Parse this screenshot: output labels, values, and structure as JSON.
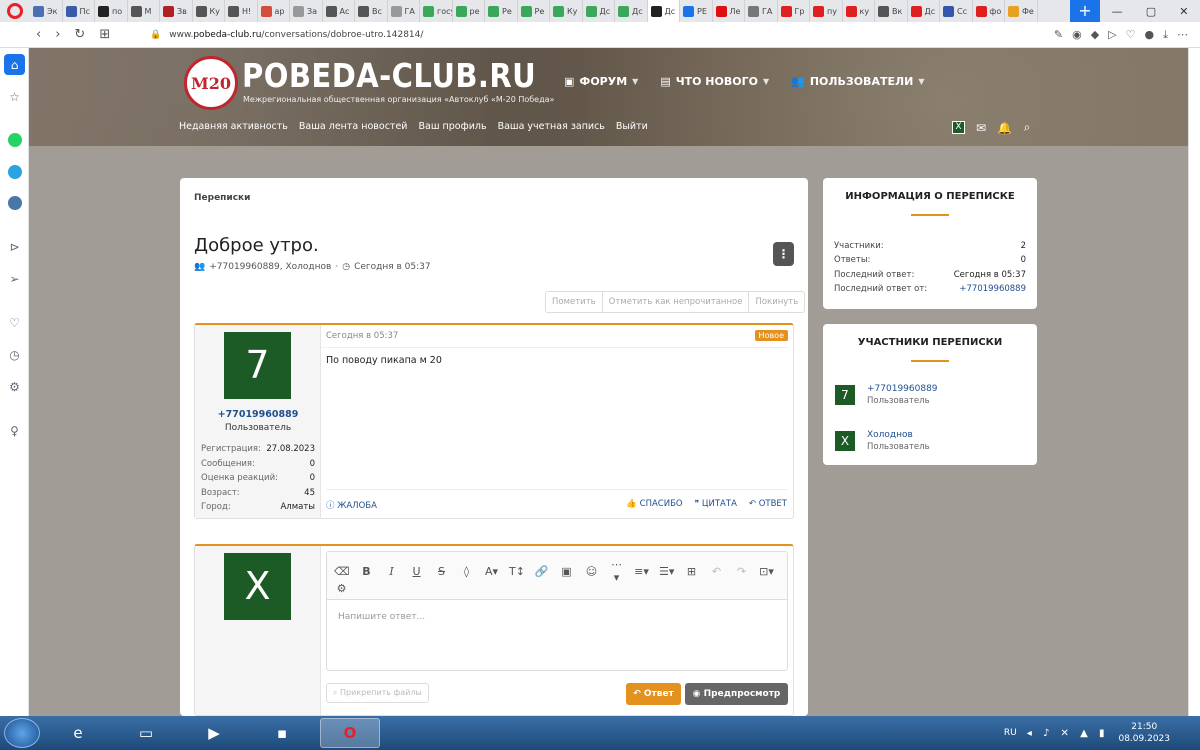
{
  "browser": {
    "tabs": [
      {
        "label": "Эк",
        "color": "#4a6fb5"
      },
      {
        "label": "Пс",
        "color": "#3a5ca8"
      },
      {
        "label": "по",
        "color": "#222222"
      },
      {
        "label": "М",
        "color": "#555555"
      },
      {
        "label": "Зв",
        "color": "#b02020"
      },
      {
        "label": "Ку",
        "color": "#555555"
      },
      {
        "label": "Н!",
        "color": "#555555"
      },
      {
        "label": "ар",
        "color": "#d44d3c"
      },
      {
        "label": "За",
        "color": "#999999"
      },
      {
        "label": "Ас",
        "color": "#555555"
      },
      {
        "label": "Вс",
        "color": "#555555"
      },
      {
        "label": "ГА",
        "color": "#999999"
      },
      {
        "label": "госу",
        "color": "#3aa75a"
      },
      {
        "label": "ре",
        "color": "#3aa75a"
      },
      {
        "label": "Ре",
        "color": "#3aa75a"
      },
      {
        "label": "Ре",
        "color": "#3aa75a"
      },
      {
        "label": "Ку",
        "color": "#3aa75a"
      },
      {
        "label": "Дс",
        "color": "#3aa75a"
      },
      {
        "label": "Дс",
        "color": "#3aa75a"
      },
      {
        "label": "Дс",
        "color": "#222222",
        "active": true
      },
      {
        "label": "РЕ",
        "color": "#1a73e8"
      },
      {
        "label": "Ле",
        "color": "#e01010"
      },
      {
        "label": "ГА",
        "color": "#777777"
      },
      {
        "label": "Гр",
        "color": "#e02020"
      },
      {
        "label": "пу",
        "color": "#e02020"
      },
      {
        "label": "ку",
        "color": "#e02020"
      },
      {
        "label": "Вк",
        "color": "#555555"
      },
      {
        "label": "Дс",
        "color": "#e02020"
      },
      {
        "label": "Сс",
        "color": "#3355aa"
      },
      {
        "label": "фо",
        "color": "#e02020"
      },
      {
        "label": "Фе",
        "color": "#e8a020"
      }
    ],
    "new_tab": "+",
    "window_controls": [
      "—",
      "▢",
      "✕"
    ],
    "url_prefix": "www.",
    "url_host": "pobeda-club.ru",
    "url_path": "/conversations/dobroe-utro.142814/"
  },
  "sidebar_icons": [
    "home-icon",
    "star-icon",
    "whatsapp-icon",
    "telegram-icon",
    "vk-icon",
    "player-icon",
    "send-icon",
    "heart-icon",
    "history-icon",
    "settings-icon",
    "tips-icon"
  ],
  "site": {
    "logo_text": "М20",
    "title": "POBEDA-CLUB.RU",
    "subtitle": "Межрегиональная общественная организация «Автоклуб «М-20 Победа»",
    "nav": [
      {
        "label": "ФОРУМ",
        "icon": "forum-icon"
      },
      {
        "label": "ЧТО НОВОГО",
        "icon": "news-icon"
      },
      {
        "label": "ПОЛЬЗОВАТЕЛИ",
        "icon": "users-icon"
      }
    ],
    "subnav": [
      "Недавняя активность",
      "Ваша лента новостей",
      "Ваш профиль",
      "Ваша учетная запись",
      "Выйти"
    ],
    "account_badge": "X"
  },
  "conversation": {
    "breadcrumb": "Переписки",
    "title": "Доброе утро.",
    "participants_summary": "+77019960889, Холоднов",
    "date": "Сегодня в 05:37",
    "actions": [
      "Пометить",
      "Отметить как непрочитанное",
      "Покинуть"
    ]
  },
  "message": {
    "avatar_letter": "7",
    "username": "+77019960889",
    "user_title": "Пользователь",
    "stats": [
      {
        "k": "Регистрация:",
        "v": "27.08.2023"
      },
      {
        "k": "Сообщения:",
        "v": "0"
      },
      {
        "k": "Оценка реакций:",
        "v": "0"
      },
      {
        "k": "Возраст:",
        "v": "45"
      },
      {
        "k": "Город:",
        "v": "Алматы"
      }
    ],
    "date": "Сегодня в 05:37",
    "badge": "Новое",
    "text": "По поводу пикапа м 20",
    "report": "ЖАЛОБА",
    "like": "СПАСИБО",
    "quote": "ЦИТАТА",
    "reply": "ОТВЕТ"
  },
  "reply": {
    "avatar_letter": "X",
    "placeholder": "Напишите ответ...",
    "attach": "Прикрепить файлы",
    "submit": "Ответ",
    "preview": "Предпросмотр"
  },
  "info": {
    "title": "ИНФОРМАЦИЯ О ПЕРЕПИСКЕ",
    "rows": [
      {
        "k": "Участники:",
        "v": "2"
      },
      {
        "k": "Ответы:",
        "v": "0"
      },
      {
        "k": "Последний ответ:",
        "v": "Сегодня в 05:37"
      },
      {
        "k": "Последний ответ от:",
        "v": "+77019960889",
        "link": true
      }
    ]
  },
  "participants": {
    "title": "УЧАСТНИКИ ПЕРЕПИСКИ",
    "list": [
      {
        "letter": "7",
        "name": "+77019960889",
        "role": "Пользователь"
      },
      {
        "letter": "X",
        "name": "Холоднов",
        "role": "Пользователь"
      }
    ]
  },
  "taskbar": {
    "lang": "RU",
    "time": "21:50",
    "date": "08.09.2023"
  }
}
